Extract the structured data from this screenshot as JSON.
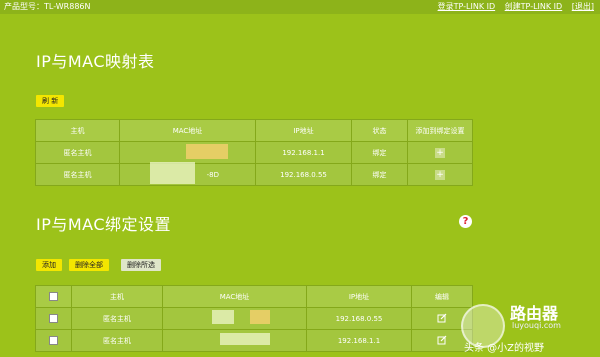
{
  "topbar": {
    "model": "产品型号：TL-WR886N",
    "login": "登录TP-LINK ID",
    "create": "创建TP-LINK ID",
    "logout": "[退出]"
  },
  "mapping": {
    "title": "IP与MAC映射表",
    "refresh": "刷 新",
    "headers": [
      "主机",
      "MAC地址",
      "IP地址",
      "状态",
      "添加到绑定设置"
    ],
    "rows": [
      {
        "host": "匿名主机",
        "mac": "",
        "ip": "192.168.1.1",
        "status": "绑定"
      },
      {
        "host": "匿名主机",
        "mac": "-8D",
        "ip": "192.168.0.55",
        "status": "绑定"
      }
    ]
  },
  "binding": {
    "title": "IP与MAC绑定设置",
    "add": "添加",
    "delete_all": "删除全部",
    "delete_selected": "删除所选",
    "headers": [
      "主机",
      "MAC地址",
      "IP地址",
      "编辑"
    ],
    "rows": [
      {
        "host": "匿名主机",
        "mac": "",
        "ip": "192.168.0.55"
      },
      {
        "host": "匿名主机",
        "mac": "",
        "ip": "192.168.1.1"
      }
    ]
  },
  "watermark": {
    "title": "路由器",
    "url": "luyouqi.com",
    "credit": "头条 @小Z的视野"
  },
  "colors": {
    "background": "#9cc21a",
    "button_yellow": "#f3e600"
  }
}
